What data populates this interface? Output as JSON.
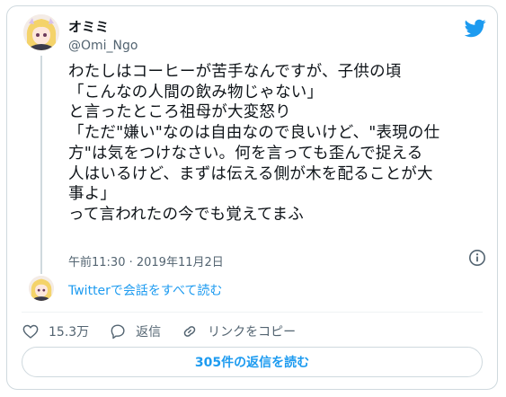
{
  "author": {
    "name": "オミミ",
    "handle": "@Omi_Ngo"
  },
  "tweet": {
    "text": "わたしはコーヒーが苦手なんですが、子供の頃\n「こんなの人間の飲み物じゃない」\nと言ったところ祖母が大変怒り\n「ただ\"嫌い\"なのは自由なので良いけど、\"表現の仕\n方\"は気をつけなさい。何を言っても歪んで捉える\n人はいるけど、まずは伝える側が木を配ることが大\n事よ」\nって言われたの今でも覚えてまふ",
    "timestamp": "午前11:30 · 2019年11月2日"
  },
  "conversation": {
    "link_label": "Twitterで会話をすべて読む"
  },
  "actions": {
    "likes": "15.3万",
    "reply_label": "返信",
    "copy_link_label": "リンクをコピー"
  },
  "read_replies_button": "305件の返信を読む",
  "colors": {
    "accent": "#1d9bf0",
    "text": "#0f1419",
    "muted": "#536471",
    "border": "#cfd9de"
  },
  "icons": [
    "twitter-bird-icon",
    "info-icon",
    "heart-icon",
    "reply-icon",
    "link-icon"
  ]
}
